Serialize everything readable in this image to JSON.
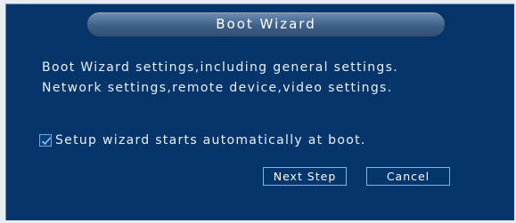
{
  "dialog": {
    "title": "Boot Wizard",
    "description_line1": "Boot Wizard settings,including general settings.",
    "description_line2": "Network settings,remote device,video settings.",
    "autostart_label": "Setup wizard starts automatically at boot.",
    "autostart_checked": true,
    "next_label": "Next Step",
    "cancel_label": "Cancel"
  },
  "colors": {
    "dialog_bg": "#05356a",
    "title_bar": "#3f6188",
    "button_border": "#7fb3ec",
    "text": "#e9f0f7"
  }
}
